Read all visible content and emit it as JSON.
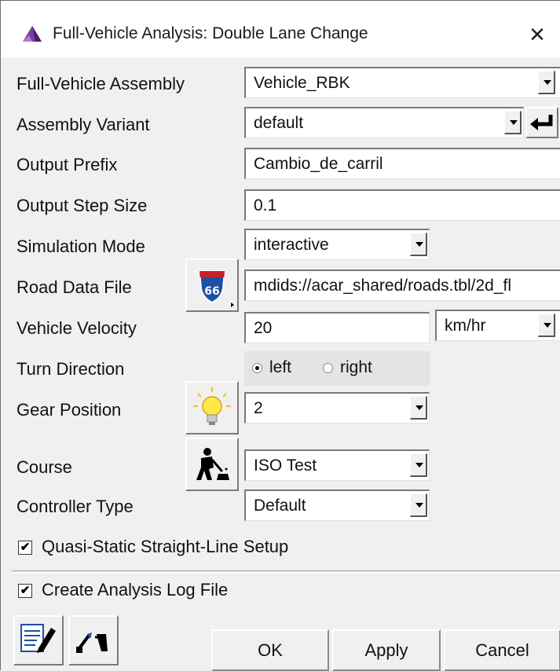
{
  "window": {
    "title": "Full-Vehicle Analysis: Double Lane Change",
    "close_symbol": "✕"
  },
  "form": {
    "assembly": {
      "label": "Full-Vehicle Assembly",
      "value": "Vehicle_RBK"
    },
    "variant": {
      "label": "Assembly Variant",
      "value": "default"
    },
    "prefix": {
      "label": "Output Prefix",
      "value": "Cambio_de_carril"
    },
    "step_size": {
      "label": "Output Step Size",
      "value": "0.1"
    },
    "sim_mode": {
      "label": "Simulation Mode",
      "value": "interactive"
    },
    "road_file": {
      "label": "Road Data File",
      "value": "mdids://acar_shared/roads.tbl/2d_fl",
      "icon": "road-sign-66-icon"
    },
    "velocity": {
      "label": "Vehicle Velocity",
      "value": "20",
      "unit": "km/hr"
    },
    "turn": {
      "label": "Turn Direction",
      "option_left": "left",
      "option_right": "right",
      "selected": "left"
    },
    "gear": {
      "label": "Gear Position",
      "value": "2",
      "icon": "lightbulb-icon"
    },
    "course": {
      "label": "Course",
      "value": "ISO Test",
      "icon": "road-worker-icon"
    },
    "controller": {
      "label": "Controller Type",
      "value": "Default"
    },
    "quasi_static": {
      "label": "Quasi-Static Straight-Line Setup",
      "checked": true
    },
    "log_file": {
      "label": "Create Analysis Log File",
      "checked": true
    }
  },
  "buttons": {
    "ok": "OK",
    "apply": "Apply",
    "cancel": "Cancel"
  },
  "check_mark": "✔"
}
